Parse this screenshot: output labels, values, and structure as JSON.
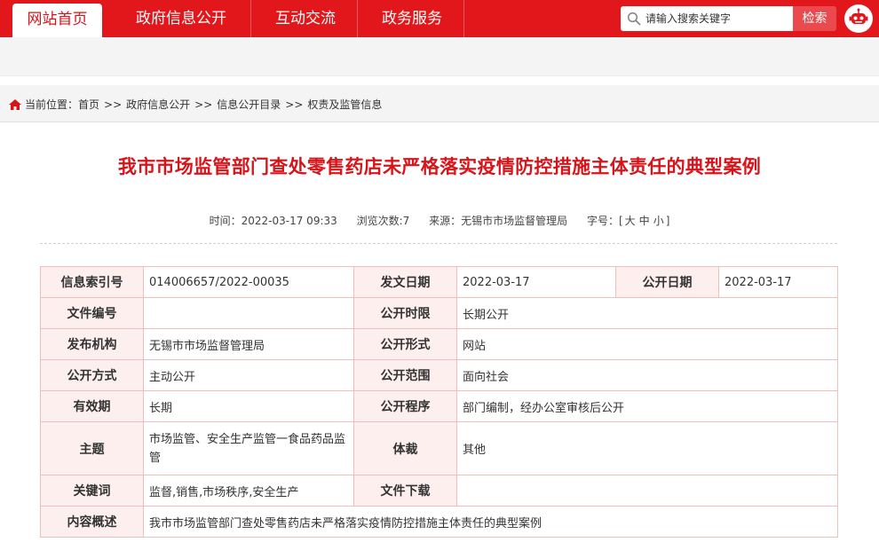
{
  "nav": {
    "tabs": [
      {
        "label": "网站首页",
        "active": true
      },
      {
        "label": "政府信息公开",
        "active": false
      },
      {
        "label": "互动交流",
        "active": false
      },
      {
        "label": "政务服务",
        "active": false
      }
    ]
  },
  "search": {
    "placeholder": "请输入搜索关键字",
    "button_label": "检索"
  },
  "breadcrumb": {
    "prefix": "当前位置：",
    "items": [
      "首页",
      "政府信息公开",
      "信息公开目录",
      "权责及监管信息"
    ],
    "separator": ">>"
  },
  "article": {
    "title": "我市市场监管部门查处零售药店未严格落实疫情防控措施主体责任的典型案例",
    "time_label": "时间：",
    "time": "2022-03-17 09:33",
    "views_label": "浏览次数:",
    "views": "7",
    "source_label": "来源：",
    "source": "无锡市市场监督管理局",
    "fontsize_label": "字号：[",
    "fontsize_large": "大",
    "fontsize_medium": "中",
    "fontsize_small": "小",
    "fontsize_close": "]"
  },
  "info_table": {
    "index_no_label": "信息索引号",
    "index_no": "014006657/2022-00035",
    "issue_date_label": "发文日期",
    "issue_date": "2022-03-17",
    "publish_date_label": "公开日期",
    "publish_date": "2022-03-17",
    "doc_no_label": "文件编号",
    "doc_no": "",
    "time_limit_label": "公开时限",
    "time_limit": "长期公开",
    "org_label": "发布机构",
    "org": "无锡市市场监督管理局",
    "form_label": "公开形式",
    "form": "网站",
    "mode_label": "公开方式",
    "mode": "主动公开",
    "scope_label": "公开范围",
    "scope": "面向社会",
    "validity_label": "有效期",
    "validity": "长期",
    "procedure_label": "公开程序",
    "procedure": "部门编制，经办公室审核后公开",
    "subject_label": "主题",
    "subject": "市场监管、安全生产监管一食品药品监管",
    "genre_label": "体裁",
    "genre": "其他",
    "keywords_label": "关键词",
    "keywords": "监督,销售,市场秩序,安全生产",
    "download_label": "文件下载",
    "download": "",
    "summary_label": "内容概述",
    "summary": "我市市场监管部门查处零售药店未严格落实疫情防控措施主体责任的典型案例"
  },
  "colors": {
    "brand_red": "#e2171c",
    "title_red": "#d7141a",
    "label_bg": "#fcefee",
    "border": "#f1bdbd"
  }
}
